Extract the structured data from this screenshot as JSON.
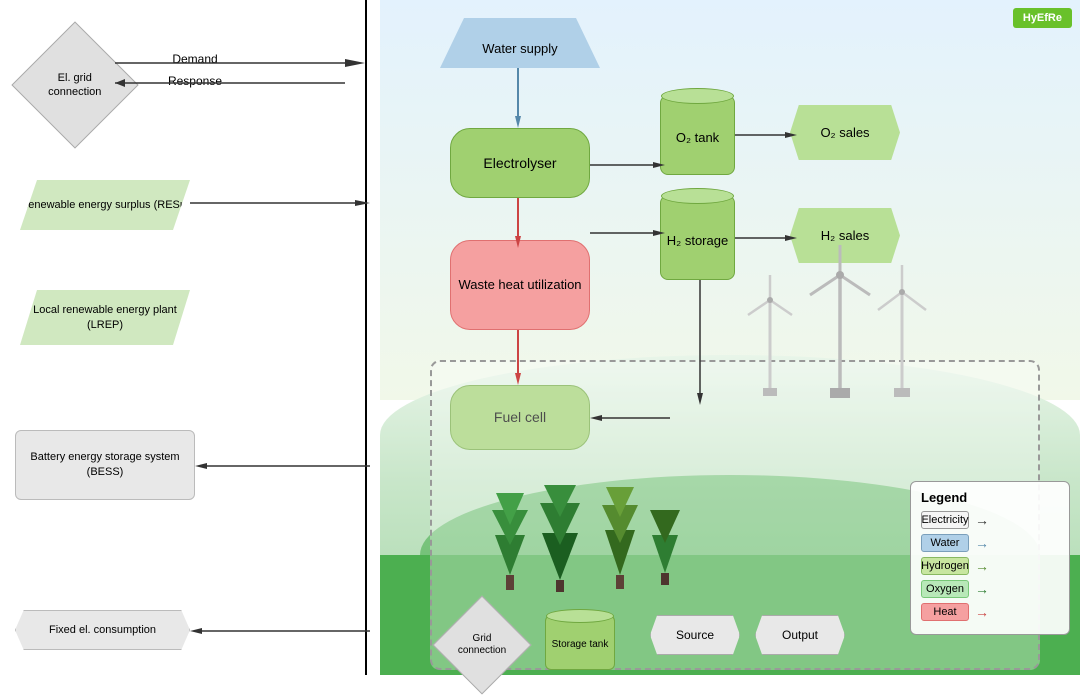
{
  "badge": {
    "label": "HyEfRe"
  },
  "shapes": {
    "el_grid": "El. grid\nconnection",
    "demand": "Demand",
    "response": "Response",
    "renewable_energy": "Renewable energy\nsurplus (RESu)",
    "local_renewable": "Local renewable\nenergy plant (LREP)",
    "battery_energy": "Battery energy\nstorage system\n(BESS)",
    "fixed_el": "Fixed el. consumption",
    "water_supply": "Water supply",
    "electrolyser": "Electrolyser",
    "waste_heat": "Waste heat\nutilization",
    "fuel_cell": "Fuel cell",
    "o2_tank": "O₂\ntank",
    "o2_sales": "O₂ sales",
    "h2_storage": "H₂\nstorage",
    "h2_sales": "H₂ sales",
    "grid_connection": "Grid\nconnection",
    "storage_tank": "Storage tank",
    "source": "Source",
    "output": "Output"
  },
  "legend": {
    "title": "Legend",
    "items": [
      {
        "label": "Electricity",
        "color": "#f5f5f5",
        "border": "#999",
        "arrow": "→"
      },
      {
        "label": "Water",
        "color": "#b0d0e8",
        "border": "#7a9fbb",
        "arrow": "→"
      },
      {
        "label": "Hydrogen",
        "color": "#c8e6a0",
        "border": "#88b860",
        "arrow": "→"
      },
      {
        "label": "Oxygen",
        "color": "#b8e8b8",
        "border": "#78c878",
        "arrow": "→"
      },
      {
        "label": "Heat",
        "color": "#f5a0a0",
        "border": "#e07070",
        "arrow": "→"
      }
    ]
  }
}
